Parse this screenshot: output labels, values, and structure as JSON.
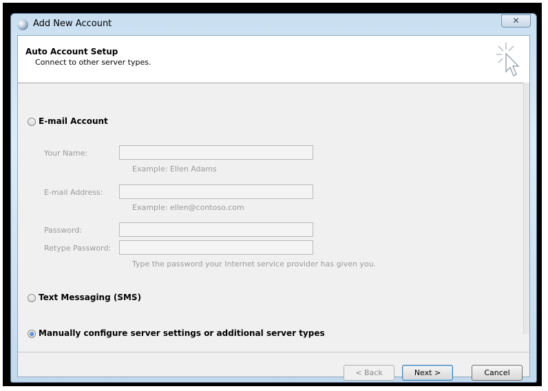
{
  "window": {
    "title": "Add New Account",
    "close_glyph": "✕"
  },
  "header": {
    "title": "Auto Account Setup",
    "subtitle": "Connect to other server types.",
    "icon": "wizard-cursor-icon"
  },
  "options": {
    "email": {
      "label": "E-mail Account",
      "selected": false
    },
    "sms": {
      "label": "Text Messaging (SMS)",
      "selected": false
    },
    "manual": {
      "label": "Manually configure server settings or additional server types",
      "selected": true
    }
  },
  "fields": {
    "name": {
      "label": "Your Name:",
      "value": "",
      "hint": "Example: Ellen Adams"
    },
    "email": {
      "label": "E-mail Address:",
      "value": "",
      "hint": "Example: ellen@contoso.com"
    },
    "password": {
      "label": "Password:",
      "value": ""
    },
    "retype": {
      "label": "Retype Password:",
      "value": "",
      "hint": "Type the password your Internet service provider has given you."
    }
  },
  "buttons": {
    "back": "< Back",
    "next": "Next >",
    "cancel": "Cancel"
  }
}
